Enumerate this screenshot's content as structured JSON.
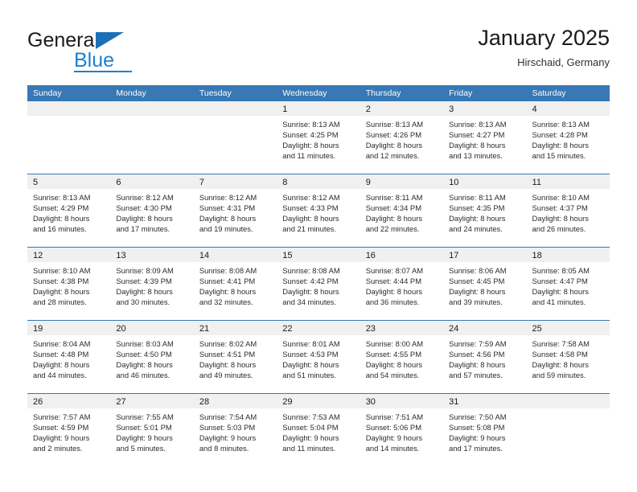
{
  "logo": {
    "word_one": "General",
    "word_two": "Blue",
    "triangle_icon": "triangle-icon"
  },
  "header": {
    "title": "January 2025",
    "subtitle": "Hirschaid, Germany"
  },
  "colors": {
    "header_blue": "#3878b4",
    "logo_blue": "#1d7fd0",
    "day_band_gray": "#f0f0f0"
  },
  "calendar": {
    "weekdays": [
      "Sunday",
      "Monday",
      "Tuesday",
      "Wednesday",
      "Thursday",
      "Friday",
      "Saturday"
    ],
    "weeks": [
      [
        {
          "day": "",
          "lines": []
        },
        {
          "day": "",
          "lines": []
        },
        {
          "day": "",
          "lines": []
        },
        {
          "day": "1",
          "lines": [
            "Sunrise: 8:13 AM",
            "Sunset: 4:25 PM",
            "Daylight: 8 hours",
            "and 11 minutes."
          ]
        },
        {
          "day": "2",
          "lines": [
            "Sunrise: 8:13 AM",
            "Sunset: 4:26 PM",
            "Daylight: 8 hours",
            "and 12 minutes."
          ]
        },
        {
          "day": "3",
          "lines": [
            "Sunrise: 8:13 AM",
            "Sunset: 4:27 PM",
            "Daylight: 8 hours",
            "and 13 minutes."
          ]
        },
        {
          "day": "4",
          "lines": [
            "Sunrise: 8:13 AM",
            "Sunset: 4:28 PM",
            "Daylight: 8 hours",
            "and 15 minutes."
          ]
        }
      ],
      [
        {
          "day": "5",
          "lines": [
            "Sunrise: 8:13 AM",
            "Sunset: 4:29 PM",
            "Daylight: 8 hours",
            "and 16 minutes."
          ]
        },
        {
          "day": "6",
          "lines": [
            "Sunrise: 8:12 AM",
            "Sunset: 4:30 PM",
            "Daylight: 8 hours",
            "and 17 minutes."
          ]
        },
        {
          "day": "7",
          "lines": [
            "Sunrise: 8:12 AM",
            "Sunset: 4:31 PM",
            "Daylight: 8 hours",
            "and 19 minutes."
          ]
        },
        {
          "day": "8",
          "lines": [
            "Sunrise: 8:12 AM",
            "Sunset: 4:33 PM",
            "Daylight: 8 hours",
            "and 21 minutes."
          ]
        },
        {
          "day": "9",
          "lines": [
            "Sunrise: 8:11 AM",
            "Sunset: 4:34 PM",
            "Daylight: 8 hours",
            "and 22 minutes."
          ]
        },
        {
          "day": "10",
          "lines": [
            "Sunrise: 8:11 AM",
            "Sunset: 4:35 PM",
            "Daylight: 8 hours",
            "and 24 minutes."
          ]
        },
        {
          "day": "11",
          "lines": [
            "Sunrise: 8:10 AM",
            "Sunset: 4:37 PM",
            "Daylight: 8 hours",
            "and 26 minutes."
          ]
        }
      ],
      [
        {
          "day": "12",
          "lines": [
            "Sunrise: 8:10 AM",
            "Sunset: 4:38 PM",
            "Daylight: 8 hours",
            "and 28 minutes."
          ]
        },
        {
          "day": "13",
          "lines": [
            "Sunrise: 8:09 AM",
            "Sunset: 4:39 PM",
            "Daylight: 8 hours",
            "and 30 minutes."
          ]
        },
        {
          "day": "14",
          "lines": [
            "Sunrise: 8:08 AM",
            "Sunset: 4:41 PM",
            "Daylight: 8 hours",
            "and 32 minutes."
          ]
        },
        {
          "day": "15",
          "lines": [
            "Sunrise: 8:08 AM",
            "Sunset: 4:42 PM",
            "Daylight: 8 hours",
            "and 34 minutes."
          ]
        },
        {
          "day": "16",
          "lines": [
            "Sunrise: 8:07 AM",
            "Sunset: 4:44 PM",
            "Daylight: 8 hours",
            "and 36 minutes."
          ]
        },
        {
          "day": "17",
          "lines": [
            "Sunrise: 8:06 AM",
            "Sunset: 4:45 PM",
            "Daylight: 8 hours",
            "and 39 minutes."
          ]
        },
        {
          "day": "18",
          "lines": [
            "Sunrise: 8:05 AM",
            "Sunset: 4:47 PM",
            "Daylight: 8 hours",
            "and 41 minutes."
          ]
        }
      ],
      [
        {
          "day": "19",
          "lines": [
            "Sunrise: 8:04 AM",
            "Sunset: 4:48 PM",
            "Daylight: 8 hours",
            "and 44 minutes."
          ]
        },
        {
          "day": "20",
          "lines": [
            "Sunrise: 8:03 AM",
            "Sunset: 4:50 PM",
            "Daylight: 8 hours",
            "and 46 minutes."
          ]
        },
        {
          "day": "21",
          "lines": [
            "Sunrise: 8:02 AM",
            "Sunset: 4:51 PM",
            "Daylight: 8 hours",
            "and 49 minutes."
          ]
        },
        {
          "day": "22",
          "lines": [
            "Sunrise: 8:01 AM",
            "Sunset: 4:53 PM",
            "Daylight: 8 hours",
            "and 51 minutes."
          ]
        },
        {
          "day": "23",
          "lines": [
            "Sunrise: 8:00 AM",
            "Sunset: 4:55 PM",
            "Daylight: 8 hours",
            "and 54 minutes."
          ]
        },
        {
          "day": "24",
          "lines": [
            "Sunrise: 7:59 AM",
            "Sunset: 4:56 PM",
            "Daylight: 8 hours",
            "and 57 minutes."
          ]
        },
        {
          "day": "25",
          "lines": [
            "Sunrise: 7:58 AM",
            "Sunset: 4:58 PM",
            "Daylight: 8 hours",
            "and 59 minutes."
          ]
        }
      ],
      [
        {
          "day": "26",
          "lines": [
            "Sunrise: 7:57 AM",
            "Sunset: 4:59 PM",
            "Daylight: 9 hours",
            "and 2 minutes."
          ]
        },
        {
          "day": "27",
          "lines": [
            "Sunrise: 7:55 AM",
            "Sunset: 5:01 PM",
            "Daylight: 9 hours",
            "and 5 minutes."
          ]
        },
        {
          "day": "28",
          "lines": [
            "Sunrise: 7:54 AM",
            "Sunset: 5:03 PM",
            "Daylight: 9 hours",
            "and 8 minutes."
          ]
        },
        {
          "day": "29",
          "lines": [
            "Sunrise: 7:53 AM",
            "Sunset: 5:04 PM",
            "Daylight: 9 hours",
            "and 11 minutes."
          ]
        },
        {
          "day": "30",
          "lines": [
            "Sunrise: 7:51 AM",
            "Sunset: 5:06 PM",
            "Daylight: 9 hours",
            "and 14 minutes."
          ]
        },
        {
          "day": "31",
          "lines": [
            "Sunrise: 7:50 AM",
            "Sunset: 5:08 PM",
            "Daylight: 9 hours",
            "and 17 minutes."
          ]
        },
        {
          "day": "",
          "lines": []
        }
      ]
    ]
  }
}
